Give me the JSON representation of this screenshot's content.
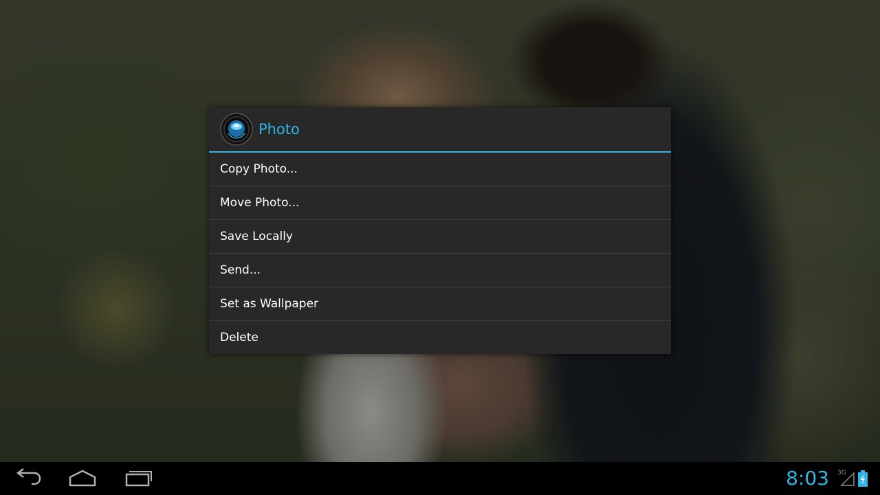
{
  "dialog": {
    "title": "Photo",
    "icon": "camera-lens-icon",
    "accent_color": "#33b5e5",
    "items": [
      {
        "label": "Copy Photo..."
      },
      {
        "label": "Move Photo..."
      },
      {
        "label": "Save Locally"
      },
      {
        "label": "Send..."
      },
      {
        "label": "Set as Wallpaper"
      },
      {
        "label": "Delete"
      }
    ]
  },
  "system_bar": {
    "back_icon": "back-arrow-icon",
    "home_icon": "home-icon",
    "recents_icon": "recent-apps-icon",
    "clock": "8:03",
    "network_type": "3G",
    "signal_icon": "signal-icon",
    "battery_icon": "battery-charging-icon"
  }
}
